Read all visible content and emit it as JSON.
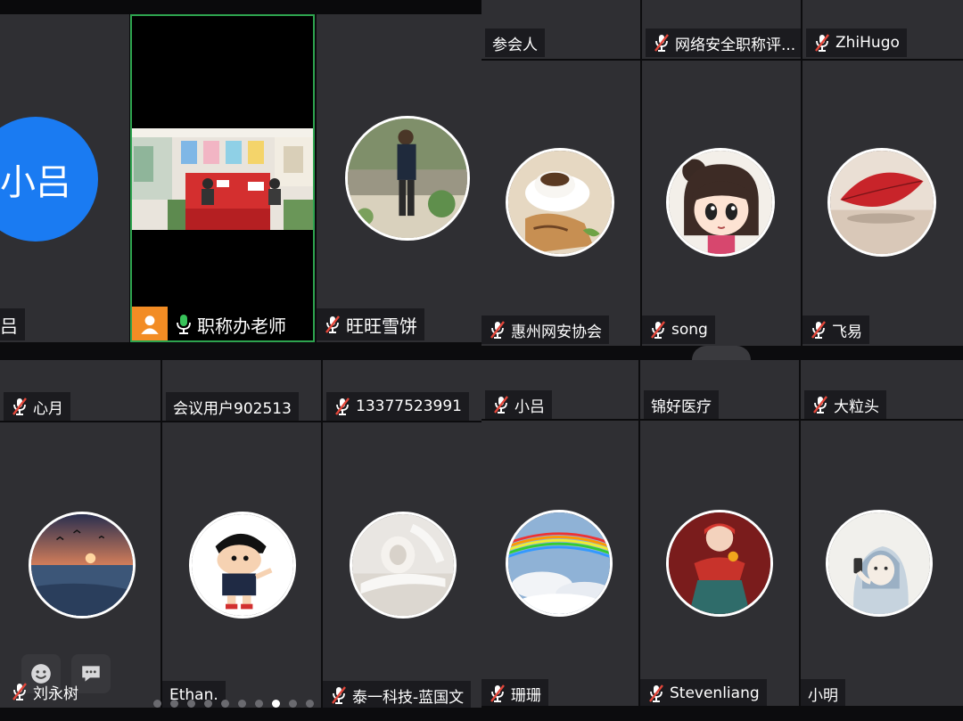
{
  "colors": {
    "tile_bg": "#2f2f33",
    "speaker_border": "#2ea44f",
    "avatar_blue": "#1a7bf2",
    "mic_off": "#e3463a",
    "mic_on": "#38c25a"
  },
  "panel_tl": {
    "left": {
      "initials": "小吕",
      "name_fragment": "吕"
    },
    "center": {
      "name": "职称办老师"
    },
    "right": {
      "name": "旺旺雪饼"
    }
  },
  "panel_tr": {
    "top_names": [
      "参会人",
      "网络安全职称评...",
      "ZhiHugo"
    ],
    "bottom_names": [
      "惠州网安协会",
      "song",
      "飞易"
    ]
  },
  "panel_bl": {
    "top_names": [
      "心月",
      "会议用户902513",
      "13377523991"
    ],
    "bottom_names": [
      "刘永树",
      "Ethan.",
      "泰一科技-蓝国文"
    ]
  },
  "panel_br": {
    "top_names": [
      "小吕",
      "锦好医疗",
      "大粒头"
    ],
    "bottom_names": [
      "珊珊",
      "Stevenliang",
      "小明"
    ]
  },
  "icons": [
    "emoji-icon",
    "chat-icon",
    "mic-off-icon",
    "mic-on-icon",
    "person-icon"
  ]
}
